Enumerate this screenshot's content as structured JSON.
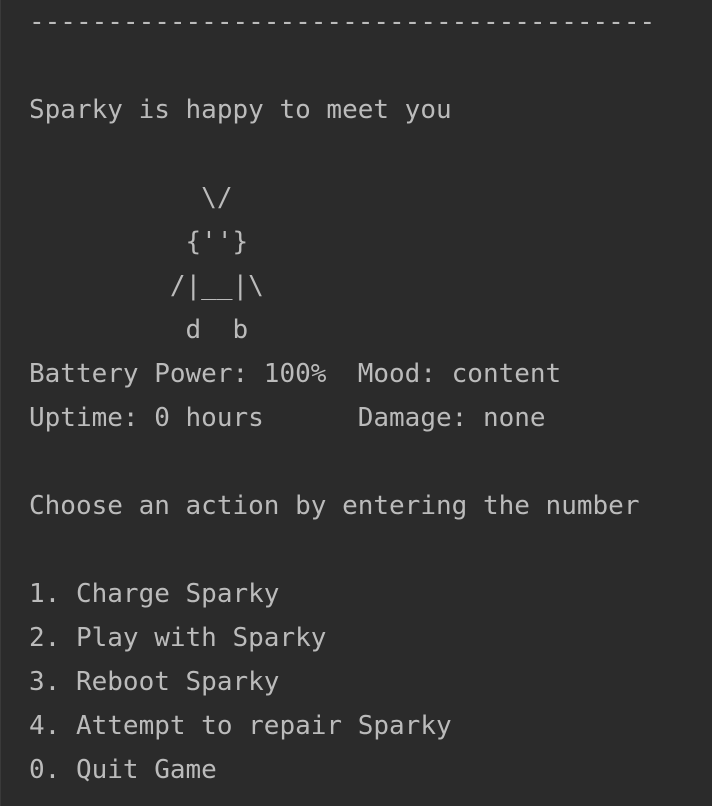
{
  "console": {
    "lines": [
      "----------------------------------------",
      "",
      "Sparky is happy to meet you",
      "",
      "           \\/",
      "          {''}",
      "         /|__|\\",
      "          d  b",
      "Battery Power: 100%  Mood: content",
      "Uptime: 0 hours      Damage: none",
      "",
      "Choose an action by entering the number",
      "",
      "1. Charge Sparky",
      "2. Play with Sparky",
      "3. Reboot Sparky",
      "4. Attempt to repair Sparky",
      "0. Quit Game"
    ]
  },
  "colors": {
    "background": "#2b2b2b",
    "text": "#bbbbbb"
  }
}
